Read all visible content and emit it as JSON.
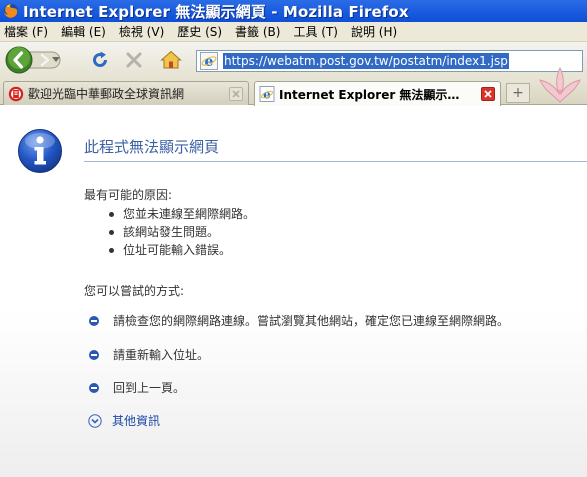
{
  "window": {
    "title": "Internet Explorer 無法顯示網頁 - Mozilla Firefox"
  },
  "menu": [
    "檔案 (F)",
    "編輯 (E)",
    "檢視 (V)",
    "歷史 (S)",
    "書籤 (B)",
    "工具 (T)",
    "說明 (H)"
  ],
  "url": "https://webatm.post.gov.tw/postatm/index1.jsp",
  "tabs": [
    {
      "label": "歡迎光臨中華郵政全球資訊網",
      "active": false
    },
    {
      "label": "Internet Explorer 無法顯示…",
      "active": true
    }
  ],
  "newtab_label": "+",
  "page": {
    "title": "此程式無法顯示網頁",
    "reasons_heading": "最有可能的原因:",
    "reasons": [
      "您並未連線至網際網路。",
      "該網站發生問題。",
      "位址可能輸入錯誤。"
    ],
    "try_heading": "您可以嘗試的方式:",
    "try_items": [
      "請檢查您的網際網路連線。嘗試瀏覽其他網站，確定您已連線至網際網路。",
      "請重新輸入位址。",
      "回到上一頁。"
    ],
    "more_info": "其他資訊"
  },
  "colors": {
    "titlebar": "#0d4fd6",
    "page_title": "#3d61a5",
    "link": "#1a47a5"
  }
}
